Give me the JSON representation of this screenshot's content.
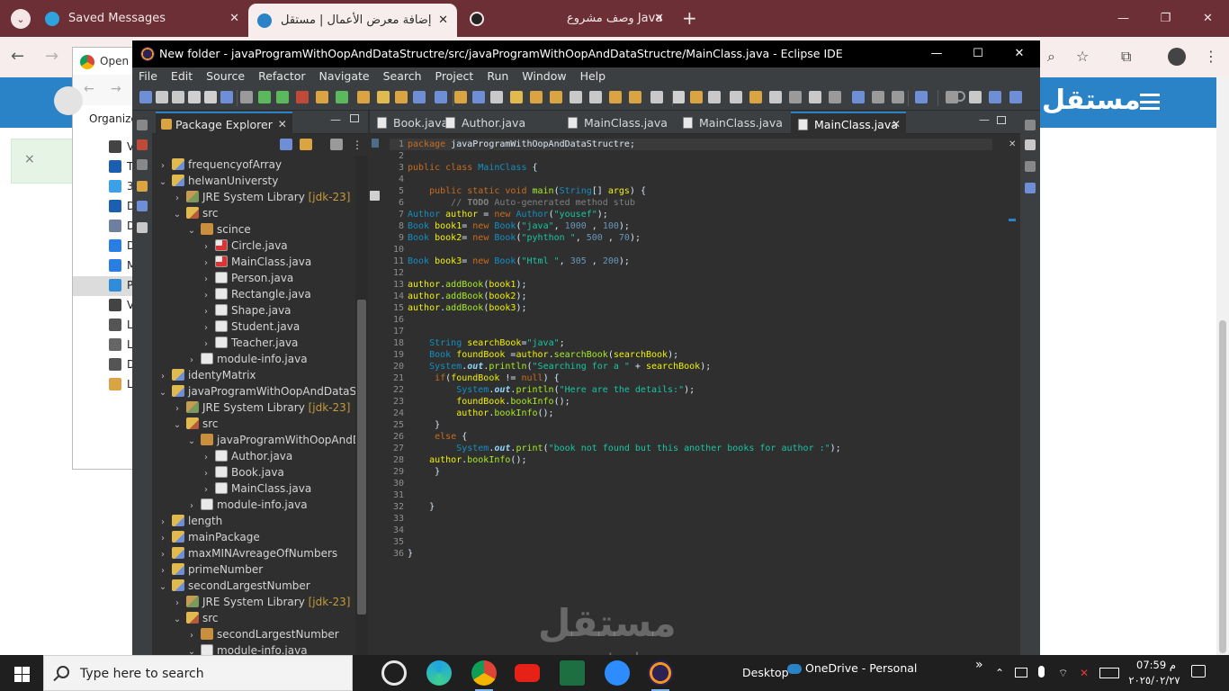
{
  "chrome": {
    "tabs": [
      {
        "title": "Saved Messages",
        "close": "✕",
        "favicon_color": "#2fa3e0"
      },
      {
        "title": "إضافة معرض الأعمال | مستقل",
        "close": "✕",
        "favicon_color": "#2a83c6"
      },
      {
        "title": "وصف مشروع Java",
        "close": "✕",
        "favicon_color": "#222222"
      }
    ],
    "new_tab": "+",
    "win_controls": [
      "—",
      "❐",
      "✕"
    ],
    "back": "←",
    "forward": "→"
  },
  "site": {
    "logo": "مستقل",
    "alert_close": "×",
    "accent": "#2a83c6"
  },
  "open_dialog": {
    "title": "Open",
    "organize": "Organize",
    "nav_back": "←",
    "nav_forward": "→",
    "items": [
      {
        "label": "V",
        "icon": "video-icon"
      },
      {
        "label": "Th",
        "icon": "this-pc-icon"
      },
      {
        "label": "3",
        "icon": "3d-objects-icon"
      },
      {
        "label": "D",
        "icon": "desktop-icon"
      },
      {
        "label": "D",
        "icon": "documents-icon"
      },
      {
        "label": "D",
        "icon": "downloads-icon"
      },
      {
        "label": "M",
        "icon": "music-icon"
      },
      {
        "label": "P",
        "icon": "pictures-icon"
      },
      {
        "label": "V",
        "icon": "videos-icon"
      },
      {
        "label": "L",
        "icon": "local-disk-icon"
      },
      {
        "label": "L",
        "icon": "drive-icon"
      },
      {
        "label": "D",
        "icon": "dvd-icon"
      },
      {
        "label": "Li",
        "icon": "libraries-icon"
      }
    ]
  },
  "eclipse": {
    "title": "New folder - javaProgramWithOopAndDataStructre/src/javaProgramWithOopAndDataStructre/MainClass.java - Eclipse IDE",
    "win_controls": [
      "—",
      "☐",
      "✕"
    ],
    "menu": [
      "File",
      "Edit",
      "Source",
      "Refactor",
      "Navigate",
      "Search",
      "Project",
      "Run",
      "Window",
      "Help"
    ],
    "package_explorer": {
      "tab": "Package Explorer",
      "close": "✕",
      "minimize": "—",
      "tree": [
        {
          "label": "frequencyofArray",
          "twisty": "›",
          "icon": "proj",
          "depth": 0
        },
        {
          "label": "helwanUniversty",
          "twisty": "⌄",
          "icon": "proj",
          "depth": 0
        },
        {
          "label": "JRE System Library",
          "deco": " [jdk-23]",
          "twisty": "›",
          "icon": "lib",
          "depth": 1
        },
        {
          "label": "src",
          "twisty": "⌄",
          "icon": "src",
          "depth": 1
        },
        {
          "label": "scince",
          "twisty": "⌄",
          "icon": "pkg",
          "depth": 2
        },
        {
          "label": "Circle.java",
          "twisty": "›",
          "icon": "javaerr",
          "depth": 3
        },
        {
          "label": "MainClass.java",
          "twisty": "›",
          "icon": "javaerr",
          "depth": 3
        },
        {
          "label": "Person.java",
          "twisty": "›",
          "icon": "java",
          "depth": 3
        },
        {
          "label": "Rectangle.java",
          "twisty": "›",
          "icon": "java",
          "depth": 3
        },
        {
          "label": "Shape.java",
          "twisty": "›",
          "icon": "java",
          "depth": 3
        },
        {
          "label": "Student.java",
          "twisty": "›",
          "icon": "java",
          "depth": 3
        },
        {
          "label": "Teacher.java",
          "twisty": "›",
          "icon": "java",
          "depth": 3
        },
        {
          "label": "module-info.java",
          "twisty": "›",
          "icon": "java",
          "depth": 2
        },
        {
          "label": "identyMatrix",
          "twisty": "›",
          "icon": "proj",
          "depth": 0
        },
        {
          "label": "javaProgramWithOopAndDataStru",
          "twisty": "⌄",
          "icon": "proj",
          "depth": 0
        },
        {
          "label": "JRE System Library",
          "deco": " [jdk-23]",
          "twisty": "›",
          "icon": "lib",
          "depth": 1
        },
        {
          "label": "src",
          "twisty": "⌄",
          "icon": "src",
          "depth": 1
        },
        {
          "label": "javaProgramWithOopAndDa",
          "twisty": "⌄",
          "icon": "pkg",
          "depth": 2
        },
        {
          "label": "Author.java",
          "twisty": "›",
          "icon": "java",
          "depth": 3
        },
        {
          "label": "Book.java",
          "twisty": "›",
          "icon": "java",
          "depth": 3
        },
        {
          "label": "MainClass.java",
          "twisty": "›",
          "icon": "java",
          "depth": 3
        },
        {
          "label": "module-info.java",
          "twisty": "›",
          "icon": "java",
          "depth": 2
        },
        {
          "label": "length",
          "twisty": "›",
          "icon": "proj",
          "depth": 0
        },
        {
          "label": "mainPackage",
          "twisty": "›",
          "icon": "proj",
          "depth": 0
        },
        {
          "label": "maxMINAvreageOfNumbers",
          "twisty": "›",
          "icon": "proj",
          "depth": 0
        },
        {
          "label": "primeNumber",
          "twisty": "›",
          "icon": "proj",
          "depth": 0
        },
        {
          "label": "secondLargestNumber",
          "twisty": "⌄",
          "icon": "proj",
          "depth": 0
        },
        {
          "label": "JRE System Library",
          "deco": " [jdk-23]",
          "twisty": "›",
          "icon": "lib",
          "depth": 1
        },
        {
          "label": "src",
          "twisty": "⌄",
          "icon": "src",
          "depth": 1
        },
        {
          "label": "secondLargestNumber",
          "twisty": "›",
          "icon": "pkg",
          "depth": 2
        },
        {
          "label": "module-info.java",
          "twisty": "⌄",
          "icon": "java",
          "depth": 2
        }
      ]
    },
    "editor": {
      "tabs": [
        {
          "label": "Book.java",
          "active": false
        },
        {
          "label": "Author.java",
          "active": false
        },
        {
          "label": "MainClass.java",
          "active": false
        },
        {
          "label": "MainClass.java",
          "active": false
        },
        {
          "label": "MainClass.java",
          "active": true
        }
      ],
      "tab_close": "✕",
      "minimize": "—"
    }
  },
  "watermark": {
    "logo": "مستقل",
    "site": "mostaql.com"
  },
  "taskbar": {
    "search_placeholder": "Type here to search",
    "desktop": "Desktop",
    "onedrive": "OneDrive - Personal",
    "time": "07:59 م",
    "date": "٢٠٢٥/٠٢/٢٧",
    "chevron": "⌃"
  }
}
